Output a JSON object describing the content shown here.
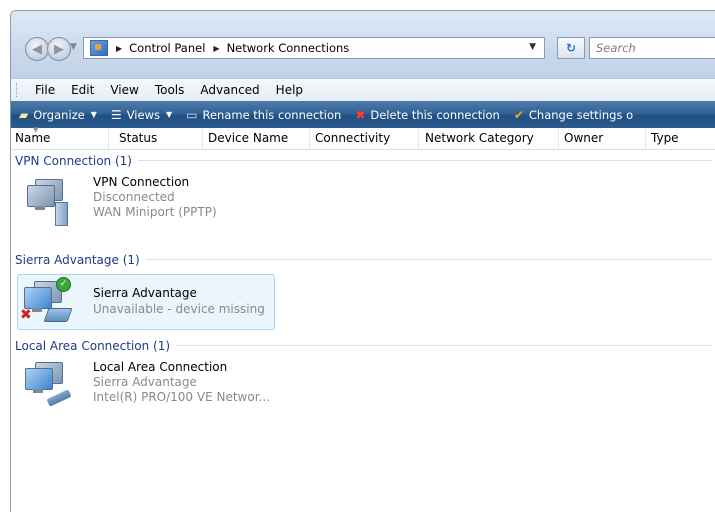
{
  "toolbar": {
    "breadcrumb": [
      "Control Panel",
      "Network Connections"
    ],
    "search_placeholder": "Search"
  },
  "menu": [
    "File",
    "Edit",
    "View",
    "Tools",
    "Advanced",
    "Help"
  ],
  "commands": [
    {
      "label": "Organize",
      "icon": "organize-icon",
      "dropdown": true
    },
    {
      "label": "Views",
      "icon": "views-icon",
      "dropdown": true
    },
    {
      "label": "Rename this connection",
      "icon": "rename-icon",
      "dropdown": false
    },
    {
      "label": "Delete this connection",
      "icon": "delete-icon",
      "dropdown": false
    },
    {
      "label": "Change settings o",
      "icon": "settings-check-icon",
      "dropdown": false
    }
  ],
  "columns": [
    "Name",
    "Status",
    "Device Name",
    "Connectivity",
    "Network Category",
    "Owner",
    "Type"
  ],
  "groups": [
    {
      "label": "VPN Connection (1)",
      "item": {
        "name": "VPN Connection",
        "lines": [
          "Disconnected",
          "WAN Miniport (PPTP)"
        ],
        "icon": "vpn-connection-icon",
        "selected": false
      }
    },
    {
      "label": "Sierra Advantage (1)",
      "item": {
        "name": "Sierra Advantage",
        "lines": [
          "Unavailable - device missing"
        ],
        "icon": "dialup-connection-icon",
        "selected": true
      }
    },
    {
      "label": "Local Area Connection (1)",
      "item": {
        "name": "Local Area Connection",
        "lines": [
          "Sierra Advantage",
          "Intel(R) PRO/100 VE Networ..."
        ],
        "icon": "lan-connection-icon",
        "selected": false
      }
    }
  ],
  "colors": {
    "accent": "#1e3a8a",
    "commandbar": "#2e5f93",
    "selection": "#eaf5fc"
  }
}
